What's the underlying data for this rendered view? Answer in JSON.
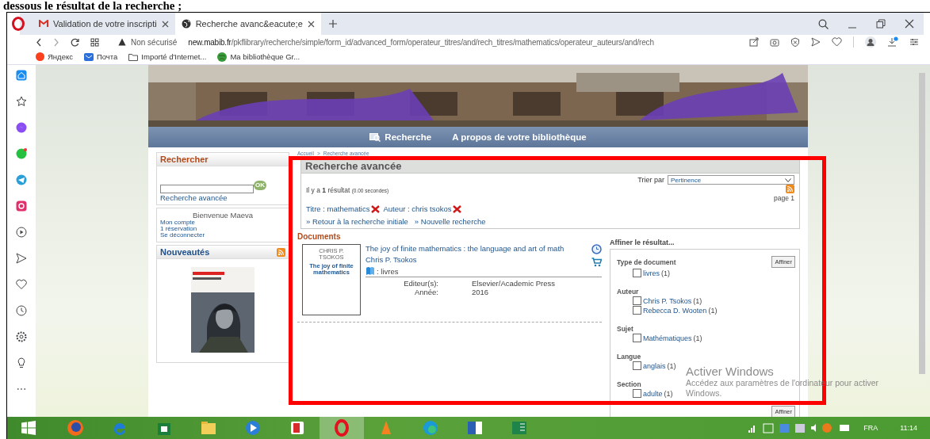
{
  "caption": "dessous le résultat de la recherche ;",
  "browser": {
    "tabs": [
      {
        "title": "Validation de votre inscripti",
        "selected": false
      },
      {
        "title": "Recherche avanc&eacute;e",
        "selected": true
      }
    ],
    "url_warning": "Non sécurisé",
    "url_host": "new.mabib.fr",
    "url_path": "/pkflibrary/recherche/simple/form_id/advanced_form/operateur_titres/and/rech_titres/mathematics/operateur_auteurs/and/rech",
    "bookmarks": [
      "Яндекс",
      "Почта",
      "Importé d'Internet...",
      "Ma bibliothèque Gr..."
    ]
  },
  "site": {
    "nav": [
      "Recherche",
      "A propos de votre bibliothèque"
    ],
    "search": {
      "title": "Rechercher",
      "button": "OK",
      "link": "Recherche avancée"
    },
    "account": {
      "welcome": "Bienvenue Maeva",
      "links": [
        "Mon compte",
        "1 réservation",
        "Se déconnecter"
      ]
    },
    "news": {
      "title": "Nouveautés"
    },
    "breadcrumb": {
      "items": [
        "Accueil",
        "Recherche avancée"
      ],
      "separator": ">"
    },
    "results": {
      "title": "Recherche avancée",
      "count": "Il y a **1** résultat",
      "time": "(0.00 secondes)",
      "sort_label": "Trier par",
      "sort_value": "Pertinence",
      "page": "page 1",
      "filters": [
        "Titre : mathematics",
        "Auteur : chris tsokos"
      ],
      "links": [
        "» Retour à la recherche initiale",
        "» Nouvelle recherche"
      ]
    },
    "documents": {
      "title": "Documents",
      "items": [
        {
          "cover_author": "CHRIS P. TSOKOS",
          "cover_title": "The joy of finite mathematics",
          "title": "The joy of finite mathematics : the language and art of math",
          "author": "Chris P. Tsokos",
          "type": ": livres",
          "fields": [
            {
              "label": "Editeur(s):",
              "value": "Elsevier/Academic Press"
            },
            {
              "label": "Année:",
              "value": "2016"
            }
          ]
        }
      ]
    },
    "refine": {
      "title": "Affiner le résultat...",
      "button": "Affiner",
      "bottom_button": "Affiner",
      "groups": [
        {
          "title": "Type de document",
          "options": [
            {
              "label": "livres",
              "count": "(1)",
              "checked": false
            }
          ]
        },
        {
          "title": "Auteur",
          "options": [
            {
              "label": "Chris P. Tsokos",
              "count": "(1)",
              "checked": false
            },
            {
              "label": "Rebecca D. Wooten",
              "count": "(1)",
              "checked": false
            }
          ]
        },
        {
          "title": "Sujet",
          "options": [
            {
              "label": "Mathématiques",
              "count": "(1)",
              "checked": false
            }
          ]
        },
        {
          "title": "Langue",
          "options": [
            {
              "label": "anglais",
              "count": "(1)",
              "checked": false
            }
          ]
        },
        {
          "title": "Section",
          "options": [
            {
              "label": "adulte",
              "count": "(1)",
              "checked": false
            }
          ]
        }
      ]
    }
  },
  "windows_notice": {
    "title": "Activer Windows",
    "text": "Accédez aux paramètres de l'ordinateur pour activer Windows."
  },
  "taskbar": {
    "language": "FRA",
    "time": "11:14"
  }
}
